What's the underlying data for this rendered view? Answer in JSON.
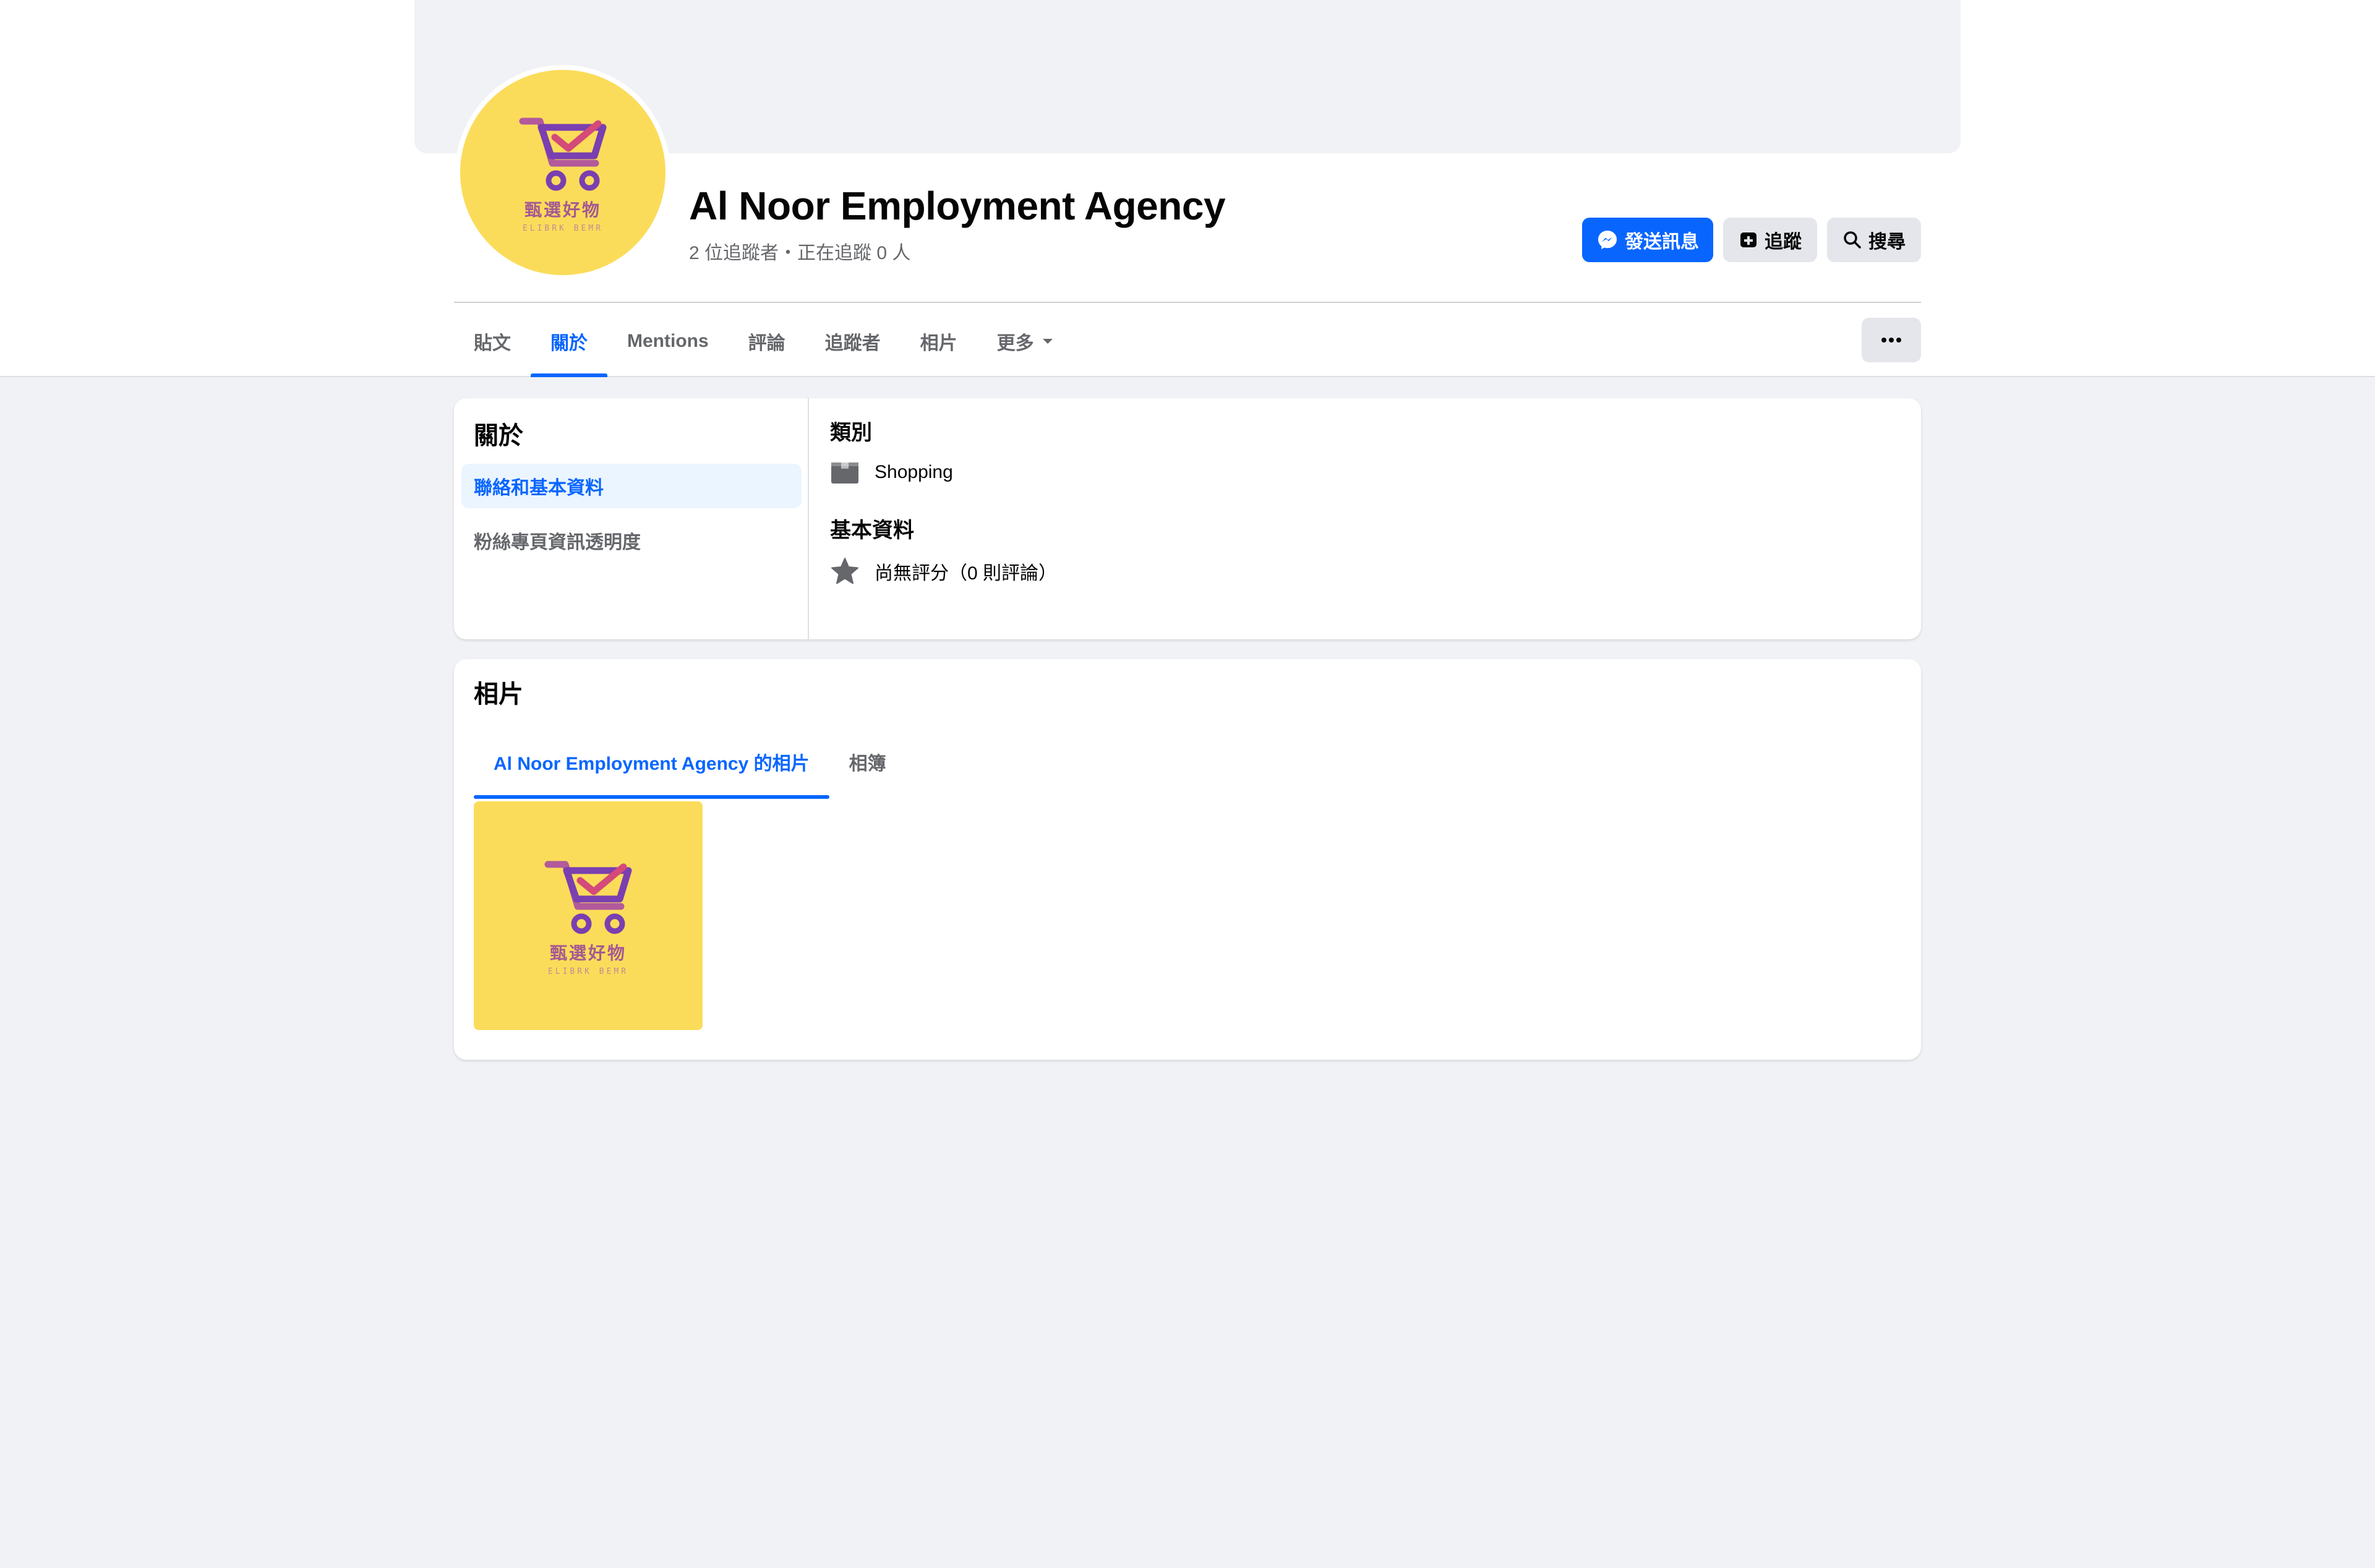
{
  "page": {
    "name": "Al Noor Employment Agency",
    "meta": "2 位追蹤者・正在追蹤 0 人",
    "logo_text": "甄選好物",
    "logo_subtext": "ELIBRK BEMR"
  },
  "actions": {
    "message_label": "發送訊息",
    "follow_label": "追蹤",
    "search_label": "搜尋"
  },
  "tabs": [
    {
      "label": "貼文"
    },
    {
      "label": "關於"
    },
    {
      "label": "Mentions"
    },
    {
      "label": "評論"
    },
    {
      "label": "追蹤者"
    },
    {
      "label": "相片"
    },
    {
      "label": "更多"
    }
  ],
  "about": {
    "title": "關於",
    "nav": [
      {
        "label": "聯絡和基本資料"
      },
      {
        "label": "粉絲專頁資訊透明度"
      }
    ],
    "category_heading": "類別",
    "category_value": "Shopping",
    "basic_heading": "基本資料",
    "rating_value": "尚無評分（0 則評論）"
  },
  "photos": {
    "title": "相片",
    "tabs": [
      {
        "label": "Al Noor Employment Agency 的相片"
      },
      {
        "label": "相簿"
      }
    ]
  },
  "colors": {
    "accent": "#0866ff",
    "logo_bg": "#fbdc5a",
    "background": "#f0f2f5"
  },
  "icons": {
    "message_button": "messenger-icon",
    "follow_button": "follow-icon",
    "search_button": "search-icon",
    "more_tab": "caret-down-icon",
    "options_button": "more-horizontal-icon",
    "category": "category-icon",
    "rating": "star-icon"
  }
}
